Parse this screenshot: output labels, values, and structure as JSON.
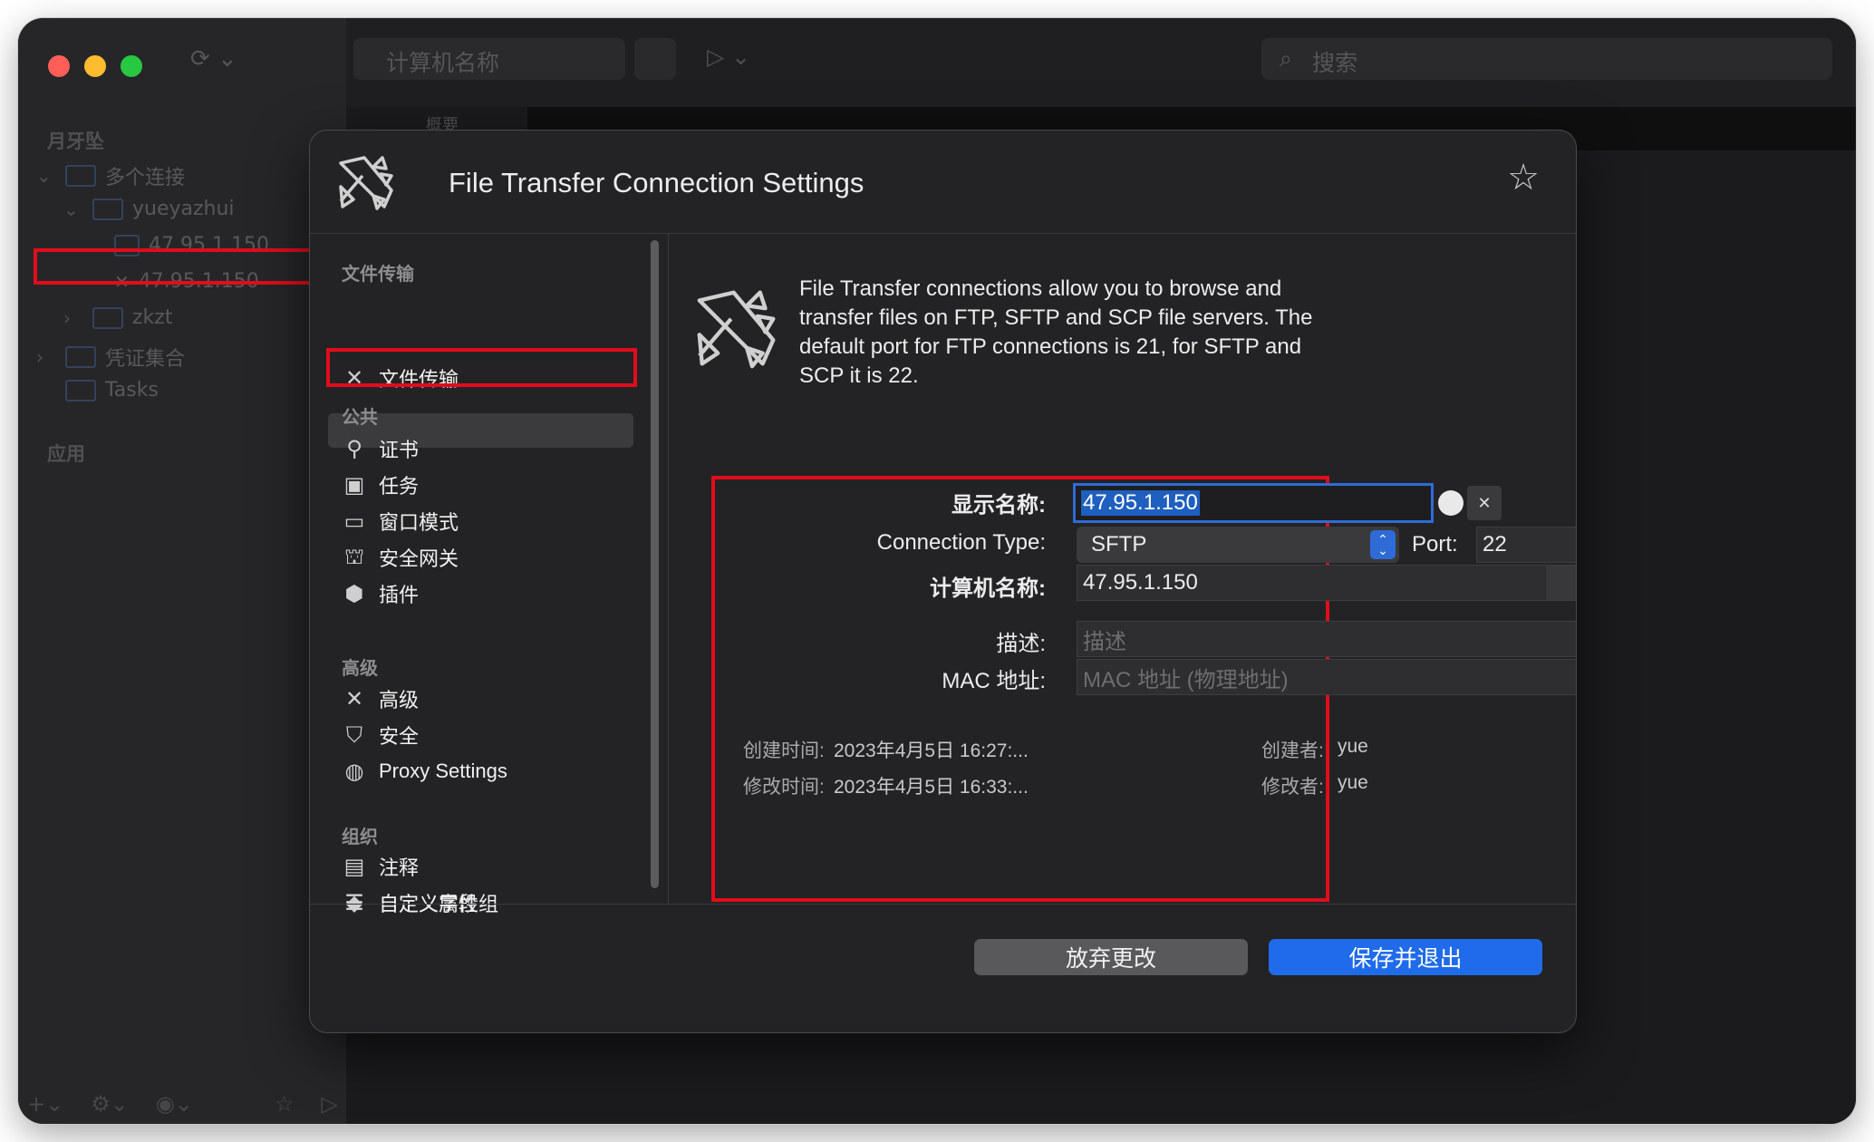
{
  "toolbar": {
    "computer_name_placeholder": "计算机名称",
    "search_placeholder": "搜索"
  },
  "sidebar": {
    "section_title": "月牙坠",
    "tree": [
      {
        "label": "多个连接",
        "level": 0,
        "expanded": true
      },
      {
        "label": "yueyazhui",
        "level": 1,
        "expanded": true
      },
      {
        "label": "47.95.1.150",
        "level": 2
      },
      {
        "label": "47.95.1.150",
        "level": 2,
        "selected": true
      },
      {
        "label": "zkzt",
        "level": 1,
        "expanded": false
      },
      {
        "label": "凭证集合",
        "level": 0,
        "expanded": false
      },
      {
        "label": "Tasks",
        "level": 0
      }
    ],
    "apps_title": "应用"
  },
  "content_tabs": [
    "概要"
  ],
  "dialog": {
    "title": "File Transfer Connection Settings",
    "nav": {
      "group_file_transfer": "文件传输",
      "item_file_transfer": "文件传输",
      "group_public": "公共",
      "public_items": [
        "证书",
        "任务",
        "窗口模式",
        "安全网关",
        "插件"
      ],
      "group_advanced": "高级",
      "advanced_items": [
        "高级",
        "安全",
        "Proxy Settings"
      ],
      "group_organize": "组织",
      "organize_items": [
        "注释",
        "自定义属性组",
        "自定义字段"
      ]
    },
    "description": "File Transfer connections allow you to browse and transfer files on FTP, SFTP and SCP file servers. The default port for FTP connections is 21, for SFTP and SCP it is 22.",
    "form": {
      "display_name_label": "显示名称:",
      "display_name_value": "47.95.1.150",
      "connection_type_label": "Connection Type:",
      "connection_type_value": "SFTP",
      "port_label": "Port:",
      "port_value": "22",
      "computer_name_label": "计算机名称:",
      "computer_name_value": "47.95.1.150",
      "description_label": "描述:",
      "description_placeholder": "描述",
      "mac_label": "MAC 地址:",
      "mac_placeholder": "MAC 地址 (物理地址)"
    },
    "meta": {
      "created_time_label": "创建时间:",
      "created_time_value": "2023年4月5日 16:27:...",
      "creator_label": "创建者:",
      "creator_value": "yue",
      "modified_time_label": "修改时间:",
      "modified_time_value": "2023年4月5日 16:33:...",
      "modifier_label": "修改者:",
      "modifier_value": "yue"
    },
    "buttons": {
      "discard": "放弃更改",
      "save_exit": "保存并退出"
    }
  },
  "colors": {
    "highlight_red": "#e00d1b",
    "accent_blue": "#1f6bea"
  }
}
